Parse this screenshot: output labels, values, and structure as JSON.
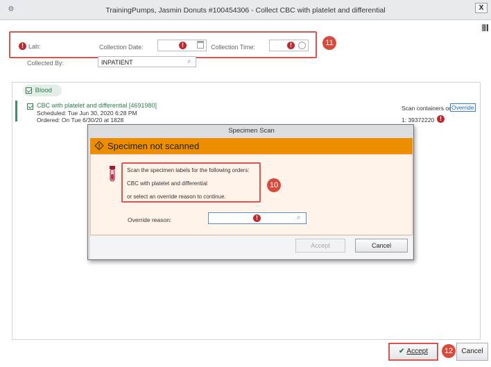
{
  "window": {
    "title": "TrainingPumps, Jasmin Donuts #100454306 - Collect CBC with platelet and differential",
    "close_label": "X"
  },
  "header": {
    "lab_label": "Lab:",
    "collection_date_label": "Collection Date:",
    "collection_time_label": "Collection Time:",
    "collected_by_label": "Collected By:",
    "collected_by_value": "INPATIENT",
    "callout_header": "11"
  },
  "order": {
    "group_label": "Blood",
    "title": "CBC with platelet and differential [4691980]",
    "scheduled": "Scheduled: Tue Jun 30, 2020 6:28 PM",
    "ordered": "Ordered: On Tue 6/30/20 at 1828",
    "scan_text": "Scan containers or",
    "override_link": "Override",
    "container_id": "1: 39372220"
  },
  "modal": {
    "title": "Specimen Scan",
    "banner": "Specimen not scanned",
    "line1": "Scan the specimen labels for the following orders:",
    "line2": "CBC with platelet and differential",
    "line3": "or select an override reason to continue.",
    "callout": "10",
    "override_label": "Override reason:",
    "accept_label": "Accept",
    "cancel_label": "Cancel"
  },
  "footer": {
    "accept_label": "Accept",
    "cancel_label": "Cancel",
    "callout": "12"
  },
  "colors": {
    "accent_green": "#2d7a4f",
    "banner_orange": "#ec8e00",
    "required_red": "#c0282d",
    "callout_red": "#d84a3c"
  }
}
